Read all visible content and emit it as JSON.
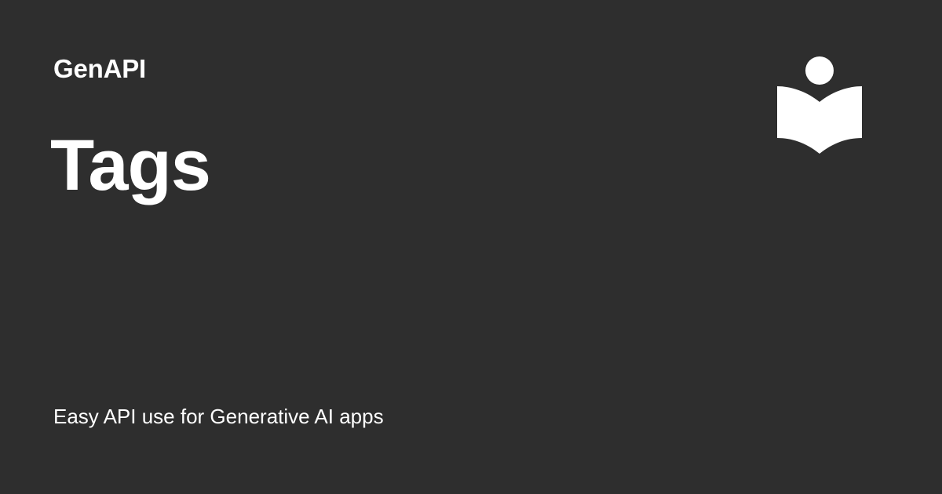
{
  "card": {
    "site_name": "GenAPI",
    "title": "Tags",
    "tagline": "Easy API use for Generative AI apps",
    "logo_icon": "reading-person-book-icon"
  },
  "colors": {
    "background": "#2e2e2e",
    "text": "#ffffff"
  }
}
